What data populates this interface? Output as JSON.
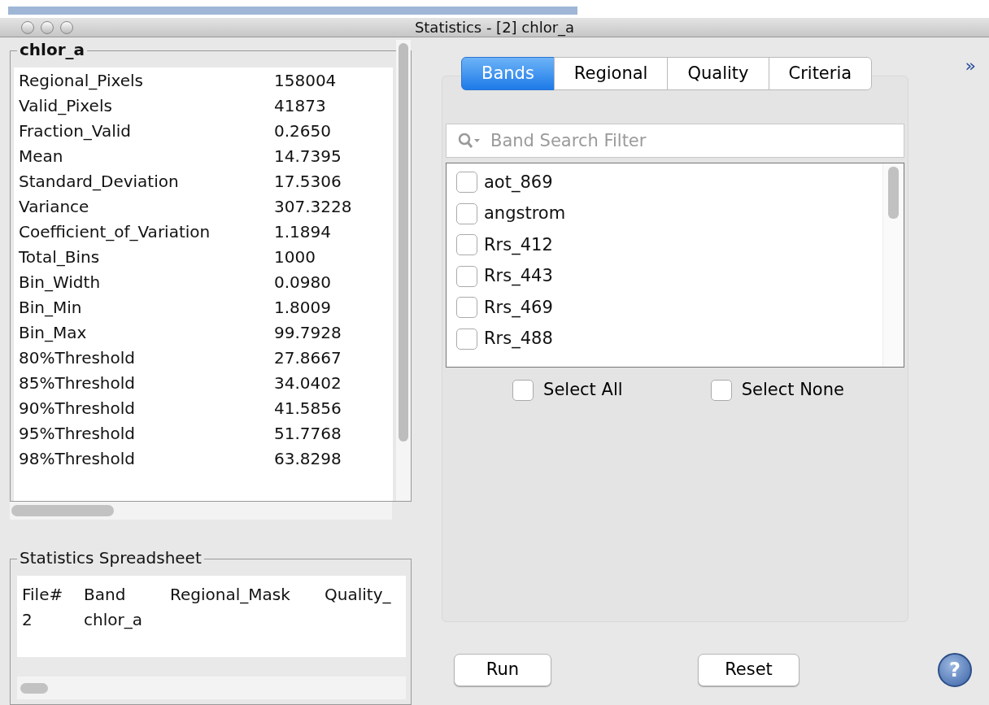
{
  "window": {
    "title": "Statistics - [2] chlor_a"
  },
  "statistics": {
    "title": "chlor_a",
    "rows": [
      {
        "name": "Regional_Pixels",
        "value": "158004"
      },
      {
        "name": "Valid_Pixels",
        "value": "41873"
      },
      {
        "name": "Fraction_Valid",
        "value": "0.2650"
      },
      {
        "name": "Mean",
        "value": "14.7395"
      },
      {
        "name": "Standard_Deviation",
        "value": "17.5306"
      },
      {
        "name": "Variance",
        "value": "307.3228"
      },
      {
        "name": "Coefficient_of_Variation",
        "value": "1.1894"
      },
      {
        "name": "Total_Bins",
        "value": "1000"
      },
      {
        "name": "Bin_Width",
        "value": "0.0980"
      },
      {
        "name": "Bin_Min",
        "value": "1.8009"
      },
      {
        "name": "Bin_Max",
        "value": "99.7928"
      },
      {
        "name": "80%Threshold",
        "value": "27.8667"
      },
      {
        "name": "85%Threshold",
        "value": "34.0402"
      },
      {
        "name": "90%Threshold",
        "value": "41.5856"
      },
      {
        "name": "95%Threshold",
        "value": "51.7768"
      },
      {
        "name": "98%Threshold",
        "value": "63.8298"
      }
    ]
  },
  "spreadsheet": {
    "title": "Statistics Spreadsheet",
    "columns": [
      "File#",
      "Band",
      "Regional_Mask",
      "Quality_"
    ],
    "rows": [
      [
        "2",
        "chlor_a"
      ]
    ]
  },
  "expand_label": "»",
  "tabs": [
    {
      "label": "Bands",
      "selected": true
    },
    {
      "label": "Regional",
      "selected": false
    },
    {
      "label": "Quality",
      "selected": false
    },
    {
      "label": "Criteria",
      "selected": false
    }
  ],
  "search": {
    "placeholder": "Band Search Filter"
  },
  "bands": [
    {
      "name": "aot_869",
      "checked": false
    },
    {
      "name": "angstrom",
      "checked": false
    },
    {
      "name": "Rrs_412",
      "checked": false
    },
    {
      "name": "Rrs_443",
      "checked": false
    },
    {
      "name": "Rrs_469",
      "checked": false
    },
    {
      "name": "Rrs_488",
      "checked": false
    }
  ],
  "select_options": [
    {
      "label": "Select All",
      "checked": false
    },
    {
      "label": "Select None",
      "checked": false
    }
  ],
  "buttons": [
    "Run",
    "Reset"
  ],
  "help_label": "?"
}
